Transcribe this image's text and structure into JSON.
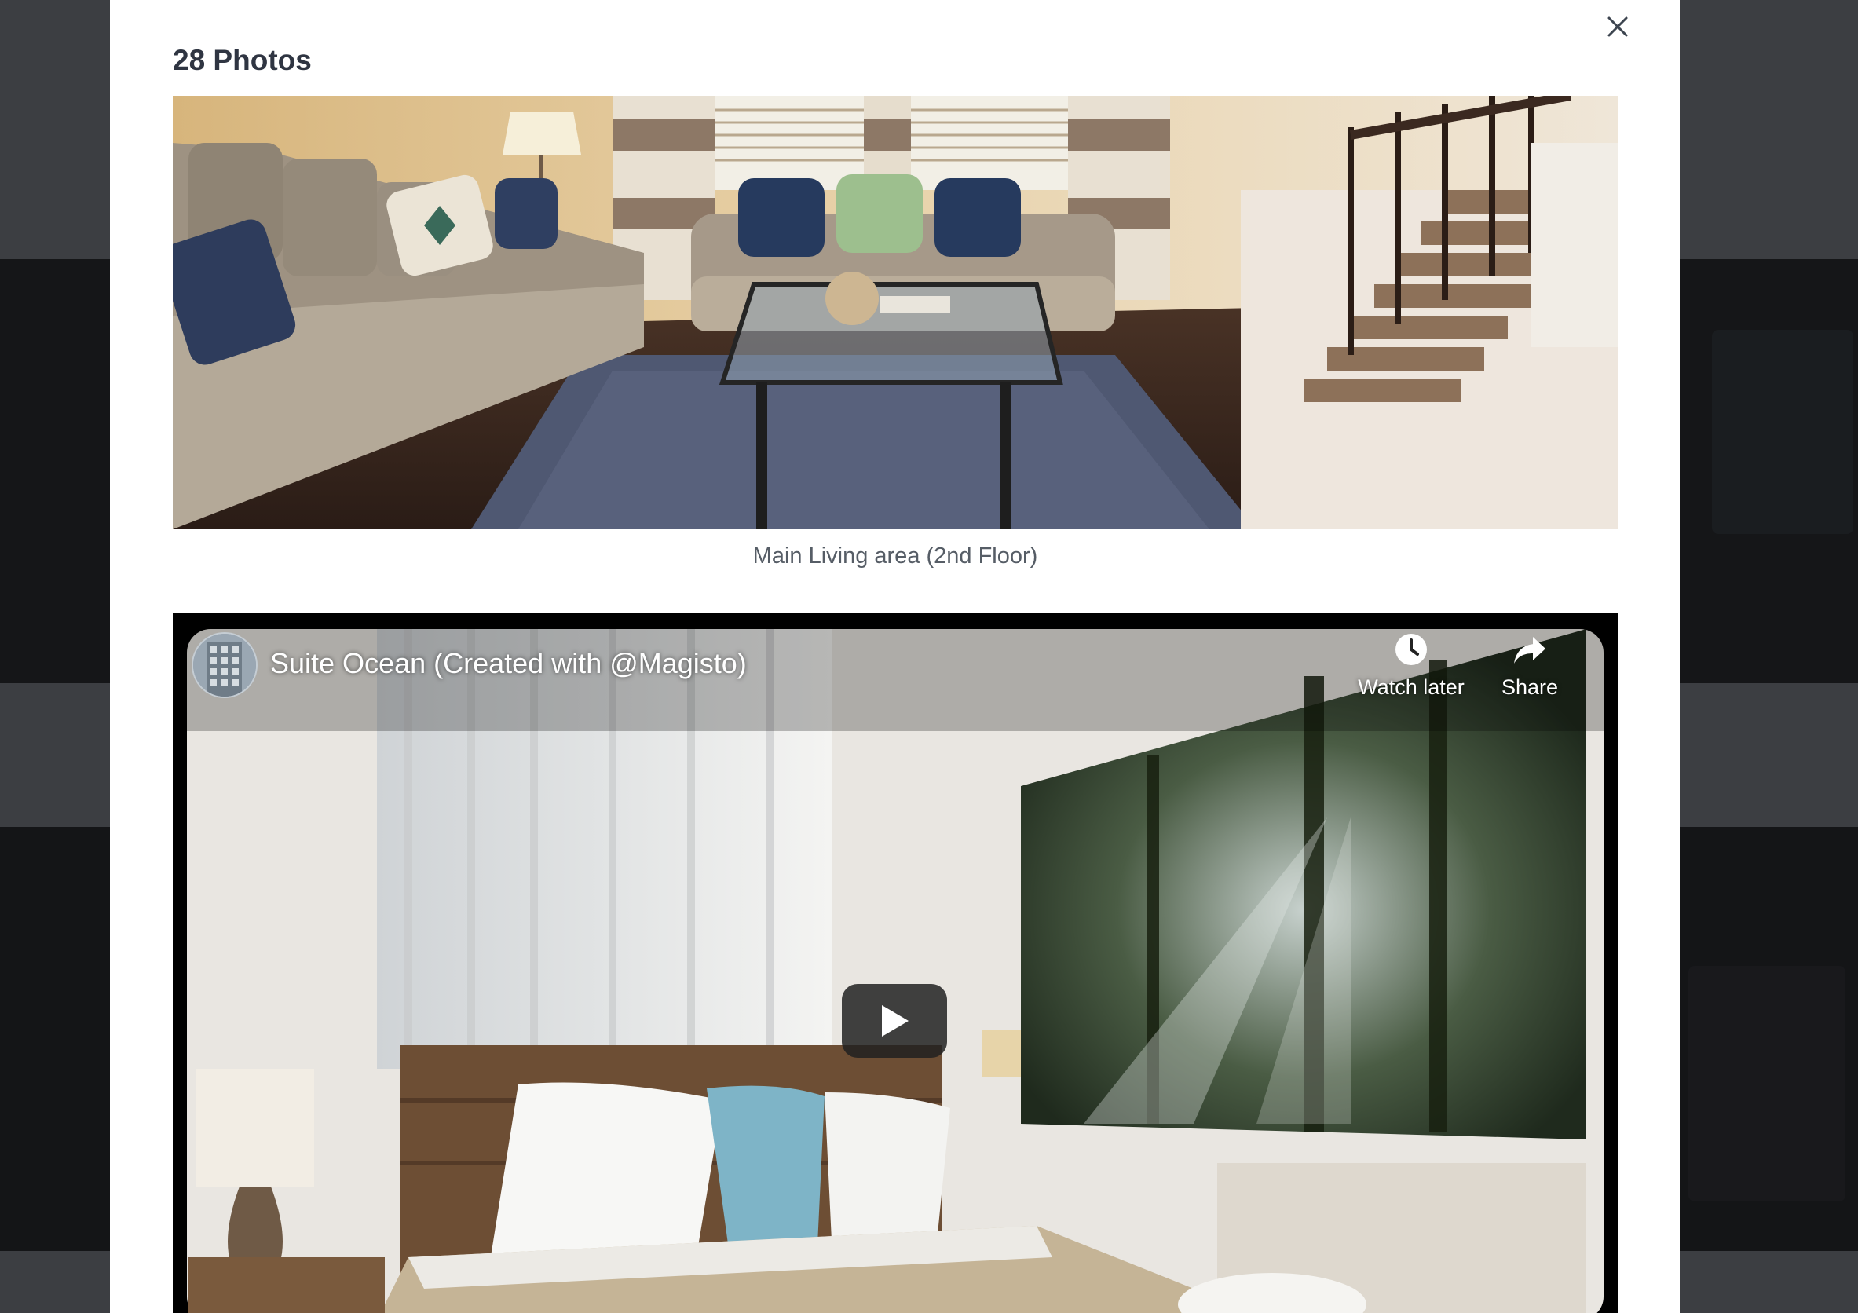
{
  "gallery": {
    "title": "28 Photos",
    "close_label": "close"
  },
  "photo": {
    "caption": "Main Living area (2nd Floor)"
  },
  "video": {
    "title": "Suite Ocean (Created with @Magisto)",
    "watch_later_label": "Watch later",
    "share_label": "Share"
  },
  "icons": {
    "close": "close-icon",
    "watch_later": "clock-icon",
    "share": "share-arrow-icon",
    "play": "play-icon"
  },
  "colors": {
    "overlay": "#3c3e42",
    "modal_bg": "#ffffff",
    "title_text": "#2f3542",
    "caption_text": "#565d66",
    "play_button": "#212121"
  }
}
